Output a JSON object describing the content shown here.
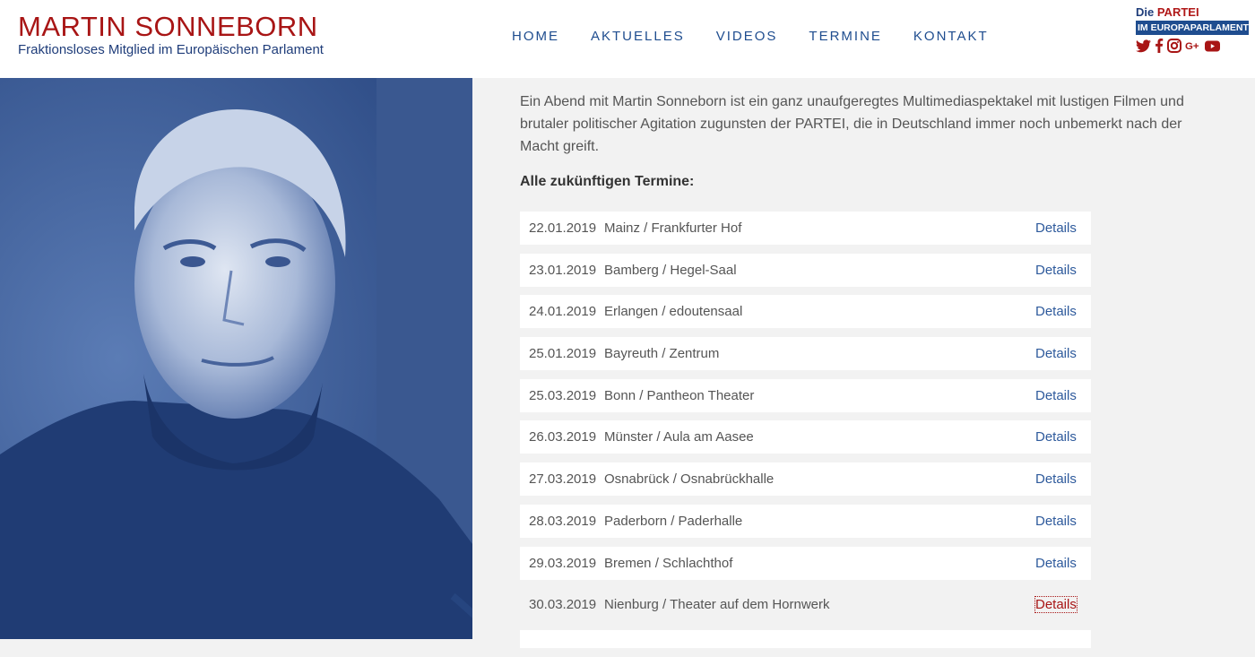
{
  "header": {
    "name": "MARTIN SONNEBORN",
    "subtitle": "Fraktionsloses Mitglied im Europäischen Parlament"
  },
  "nav": [
    {
      "label": "HOME"
    },
    {
      "label": "AKTUELLES"
    },
    {
      "label": "VIDEOS"
    },
    {
      "label": "TERMINE"
    },
    {
      "label": "KONTAKT"
    }
  ],
  "logo": {
    "line1_prefix": "Die ",
    "line1_brand": "PARTEI",
    "line2": "IM EUROPAPARLAMENT"
  },
  "social_icons": [
    "twitter-icon",
    "facebook-icon",
    "instagram-icon",
    "google-plus-icon",
    "youtube-icon"
  ],
  "colors": {
    "accent_red": "#a81515",
    "brand_blue": "#1f4d8f",
    "photo_blue": "#4a6aa6"
  },
  "content": {
    "intro": "Ein Abend mit Martin Sonneborn ist ein ganz unaufgeregtes Multimediaspektakel mit lustigen Filmen und brutaler politischer Agitation zugunsten der PARTEI, die in Deutschland immer noch unbemerkt nach der Macht greift.",
    "list_heading": "Alle zukünftigen Termine:"
  },
  "events": [
    {
      "date": "22.01.2019",
      "venue": "Mainz / Frankfurter Hof",
      "link": "Details"
    },
    {
      "date": "23.01.2019",
      "venue": "Bamberg / Hegel-Saal",
      "link": "Details"
    },
    {
      "date": "24.01.2019",
      "venue": "Erlangen / edoutensaal",
      "link": "Details"
    },
    {
      "date": "25.01.2019",
      "venue": "Bayreuth / Zentrum",
      "link": "Details"
    },
    {
      "date": "25.03.2019",
      "venue": "Bonn / Pantheon Theater",
      "link": "Details"
    },
    {
      "date": "26.03.2019",
      "venue": "Münster / Aula am Aasee",
      "link": "Details"
    },
    {
      "date": "27.03.2019",
      "venue": "Osnabrück / Osnabrückhalle",
      "link": "Details"
    },
    {
      "date": "28.03.2019",
      "venue": "Paderborn / Paderhalle",
      "link": "Details"
    },
    {
      "date": "29.03.2019",
      "venue": "Bremen / Schlachthof",
      "link": "Details"
    },
    {
      "date": "30.03.2019",
      "venue": "Nienburg / Theater auf dem Hornwerk",
      "link": "Details"
    }
  ]
}
